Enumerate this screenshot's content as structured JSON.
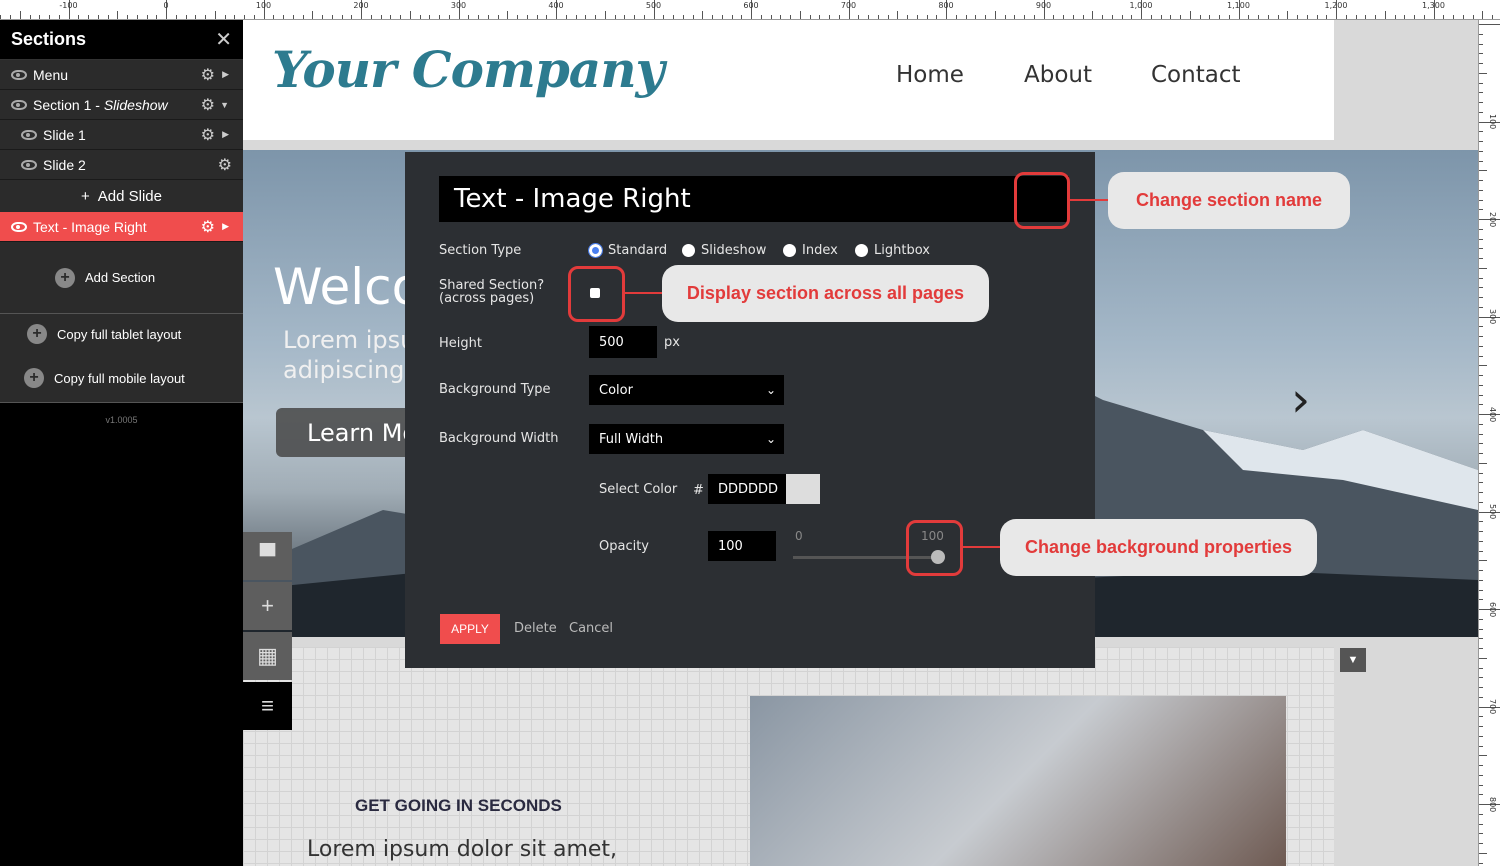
{
  "ruler": {
    "top_labels": [
      "-100",
      "0",
      "100",
      "200",
      "300",
      "400",
      "500",
      "600",
      "700",
      "800",
      "900",
      "1,000",
      "1,100",
      "1,200",
      "1,300"
    ],
    "side_labels": [
      "100",
      "200",
      "300",
      "400",
      "500",
      "600",
      "700",
      "800"
    ]
  },
  "sidebar": {
    "title": "Sections",
    "items": [
      {
        "label": "Menu",
        "type": "section"
      },
      {
        "label": "Section 1 - ",
        "italic": "Slideshow",
        "type": "section"
      },
      {
        "label": "Slide 1",
        "type": "slide"
      },
      {
        "label": "Slide 2",
        "type": "slide"
      }
    ],
    "add_slide": "Add Slide",
    "active_item": "Text - Image Right",
    "add_section": "Add Section",
    "copy_tablet": "Copy full tablet layout",
    "copy_mobile": "Copy full mobile layout",
    "version": "v1.0005"
  },
  "site": {
    "logo": "Your Company",
    "nav": [
      "Home",
      "About",
      "Contact"
    ],
    "hero_title": "Welcome to our",
    "hero_text_1": "Lorem ipsum dolor sit amet, consectetur",
    "hero_text_2": "adipiscing elit.",
    "hero_button": "Learn More",
    "below_heading": "GET GOING IN SECONDS",
    "below_text": "Lorem ipsum dolor sit amet,"
  },
  "modal": {
    "name_value": "Text - Image Right",
    "section_type_label": "Section Type",
    "section_types": [
      "Standard",
      "Slideshow",
      "Index",
      "Lightbox"
    ],
    "selected_type": "Standard",
    "shared_label": "Shared Section?",
    "shared_sub": "(across pages)",
    "height_label": "Height",
    "height_value": "500",
    "height_unit": "px",
    "bg_type_label": "Background Type",
    "bg_type_value": "Color",
    "bg_width_label": "Background Width",
    "bg_width_value": "Full Width",
    "select_color_label": "Select Color",
    "hash": "#",
    "color_value": "DDDDDD",
    "color_swatch": "#dddddd",
    "opacity_label": "Opacity",
    "opacity_value": "100",
    "slider_min": "0",
    "slider_max": "100",
    "apply": "APPLY",
    "delete": "Delete",
    "cancel": "Cancel"
  },
  "callouts": {
    "name": "Change section name",
    "shared": "Display section across all pages",
    "background": "Change background properties"
  },
  "colors": {
    "accent": "#f04d4d",
    "callout_text": "#e23b3b",
    "logo": "#2d7b8f"
  }
}
